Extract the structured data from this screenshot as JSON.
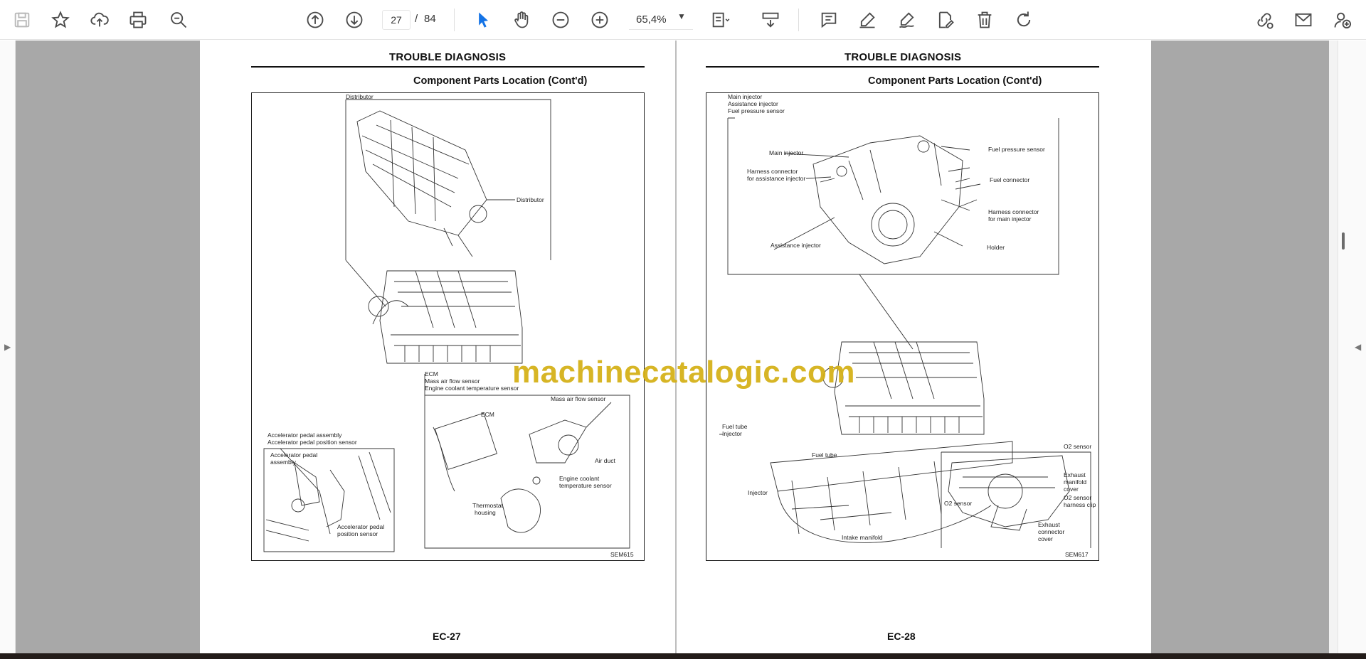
{
  "toolbar": {
    "page_current": "27",
    "page_separator": "/",
    "page_total": "84",
    "zoom": "65,4%"
  },
  "pages": [
    {
      "title": "TROUBLE DIAGNOSIS",
      "subtitle": "Component Parts Location (Cont'd)",
      "page_number": "EC-27",
      "figure_code": "SEM615",
      "labels": {
        "distributor_top": "Distributor",
        "distributor": "Distributor",
        "ecm_header_1": "ECM",
        "ecm_header_2": "Mass air flow sensor",
        "ecm_header_3": "Engine coolant temperature sensor",
        "maf_sensor": "Mass air flow sensor",
        "air_duct": "Air duct",
        "ect_sensor_1": "Engine coolant",
        "ect_sensor_2": "temperature sensor",
        "thermostat_1": "Thermostat",
        "thermostat_2": "housing",
        "ecm": "ECM",
        "accel_header_1": "Accelerator pedal assembly",
        "accel_header_2": "Accelerator pedal position sensor",
        "accel_assembly_1": "Accelerator pedal",
        "accel_assembly_2": "assembly",
        "accel_sensor_1": "Accelerator pedal",
        "accel_sensor_2": "position sensor"
      }
    },
    {
      "title": "TROUBLE DIAGNOSIS",
      "subtitle": "Component Parts Location (Cont'd)",
      "page_number": "EC-28",
      "figure_code": "SEM617",
      "labels": {
        "header_1": "Main injector",
        "header_2": "Assistance injector",
        "header_3": "Fuel pressure sensor",
        "main_injector": "Main injector",
        "harness_assist_1": "Harness connector",
        "harness_assist_2": "for assistance injector",
        "fuel_pressure_sensor": "Fuel pressure sensor",
        "fuel_connector": "Fuel connector",
        "harness_main_1": "Harness connector",
        "harness_main_2": "for main injector",
        "assistance_injector": "Assistance injector",
        "holder": "Holder",
        "fuel_tube_1": "Fuel tube",
        "fuel_tube_2": "Injector",
        "fuel_tube": "Fuel tube",
        "injector": "Injector",
        "intake_manifold": "Intake manifold",
        "o2_sensor_top": "O2 sensor",
        "exhaust_1": "Exhaust",
        "exhaust_2": "manifold",
        "exhaust_3": "cover",
        "o2_harness_1": "O2 sensor",
        "o2_harness_2": "harness clip",
        "o2_sensor": "O2 sensor",
        "exhaust_conn_1": "Exhaust",
        "exhaust_conn_2": "connector",
        "exhaust_conn_3": "cover"
      }
    }
  ],
  "watermark": "machinecatalogic.com",
  "icons": {
    "save": "save-icon",
    "bookmark": "star-icon",
    "upload": "cloud-upload-icon",
    "print": "printer-icon",
    "find": "zoom-search-icon",
    "prev_page": "arrow-up-circle-icon",
    "next_page": "arrow-down-circle-icon",
    "select": "cursor-icon",
    "hand": "hand-icon",
    "zoom_out": "zoom-out-icon",
    "zoom_in": "zoom-in-icon",
    "fit": "fit-page-icon",
    "scroll": "scroll-mode-icon",
    "comment": "comment-icon",
    "highlight": "pen-icon",
    "sign": "sign-icon",
    "edit": "edit-doc-icon",
    "delete": "trash-icon",
    "rotate": "rotate-icon",
    "share_link": "link-icon",
    "email": "email-icon",
    "add_user": "add-user-icon"
  },
  "colors": {
    "accent": "#1473e6",
    "watermark": "#d5b21a",
    "canvas": "#a8a8a8"
  }
}
